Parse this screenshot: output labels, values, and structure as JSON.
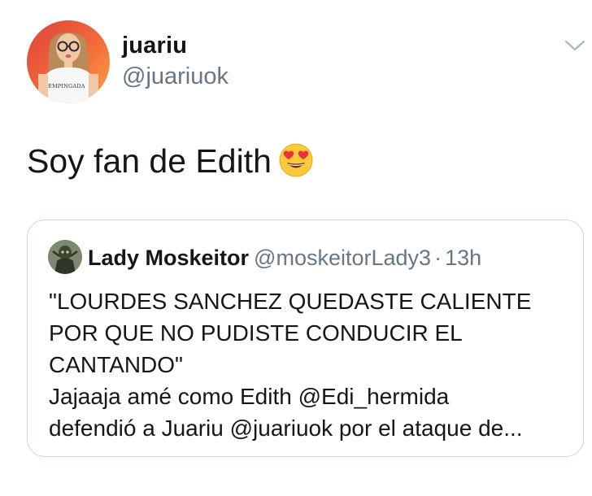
{
  "tweet": {
    "display_name": "juariu",
    "handle": "@juariuok",
    "avatar_shirt_text": "EMPINGADA",
    "text": "Soy fan de Edith",
    "emoji": "heart-eyes-emoji"
  },
  "quoted_tweet": {
    "display_name": "Lady Moskeitor",
    "handle": "@moskeitorLady3",
    "separator": "·",
    "time": "13h",
    "lines": [
      "\"LOURDES SANCHEZ QUEDASTE CALIENTE",
      "POR QUE NO PUDISTE CONDUCIR EL",
      "CANTANDO\"",
      "Jajaaja amé como Edith @Edi_hermida",
      "defendió a Juariu @juariuok por el ataque de..."
    ]
  },
  "icons": {
    "menu": "chevron-down-icon"
  },
  "colors": {
    "primary_text": "#14171a",
    "secondary_text": "#657786",
    "card_border": "#ccd6dd"
  }
}
